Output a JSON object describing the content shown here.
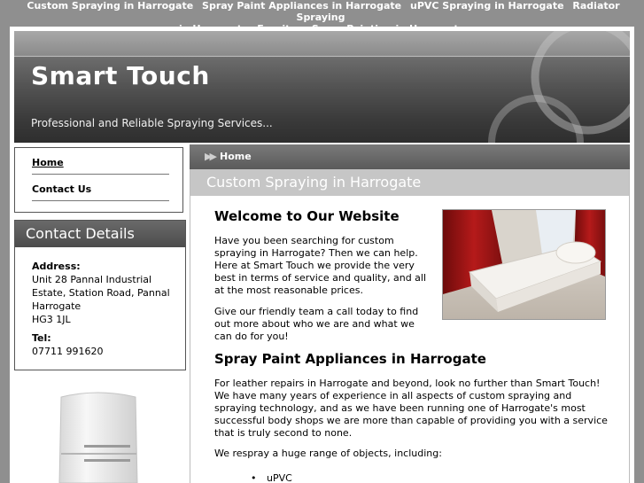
{
  "top_nav": {
    "row1": [
      "Custom Spraying in Harrogate",
      "Spray Paint Appliances in Harrogate",
      "uPVC Spraying in Harrogate",
      "Radiator Spraying"
    ],
    "row2": [
      "in Harrogate",
      "Furniture Spray Painting in Harrogate"
    ]
  },
  "header": {
    "title": "Smart Touch",
    "tagline": "Professional and Reliable Spraying Services..."
  },
  "left_nav": {
    "items": [
      {
        "label": "Home"
      },
      {
        "label": "Contact Us"
      }
    ]
  },
  "contact": {
    "heading": "Contact Details",
    "address_label": "Address:",
    "address_lines": [
      "Unit 28 Pannal Industrial",
      "Estate, Station Road, Pannal",
      "Harrogate",
      "HG3 1JL"
    ],
    "tel_label": "Tel:",
    "tel": "07711 991620"
  },
  "breadcrumb": {
    "label": "Home"
  },
  "main": {
    "page_title": "Custom Spraying in Harrogate",
    "welcome_heading": "Welcome to Our Website",
    "intro_p1": "Have you been searching for custom spraying in Harrogate? Then we can help. Here at Smart Touch we provide the very best in terms of service and quality, and all at the most reasonable prices.",
    "intro_p2": "Give our friendly team a call today to find out more about who we are and what we can do for you!",
    "spray_heading": "Spray Paint Appliances in Harrogate",
    "spray_p1": "For leather repairs in Harrogate and beyond, look no further than Smart Touch! We have many years of experience in all aspects of custom spraying and spraying technology, and as we have been running one of Harrogate's most successful body shops we are more than capable of providing you with a service that is truly second to none.",
    "spray_p2": "We respray a huge range of objects, including:",
    "list_items": [
      "uPVC"
    ]
  },
  "colors": {
    "page_bg": "#8f8f8f",
    "header_dark": "#2e2e2e",
    "title_bar": "#c6c6c6"
  }
}
